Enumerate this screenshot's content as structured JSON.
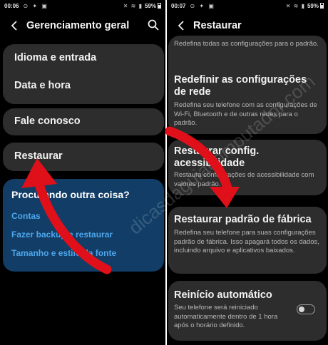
{
  "left": {
    "status": {
      "time": "00:06",
      "battery": "59%"
    },
    "header": {
      "title": "Gerenciamento geral"
    },
    "items": [
      {
        "label": "Idioma e entrada"
      },
      {
        "label": "Data e hora"
      },
      {
        "label": "Fale conosco"
      },
      {
        "label": "Restaurar"
      }
    ],
    "suggestions": {
      "heading": "Procurando outra coisa?",
      "links": [
        "Contas",
        "Fazer backup e restaurar",
        "Tamanho e estilo da fonte"
      ]
    }
  },
  "right": {
    "status": {
      "time": "00:07",
      "battery": "59%"
    },
    "header": {
      "title": "Restaurar"
    },
    "top_partial_desc": "Redefina todas as configurações para o padrão.",
    "options": [
      {
        "title": "Redefinir as configurações de rede",
        "desc": "Redefina seu telefone com as configurações de Wi-Fi, Bluetooth e de outras redes para o padrão."
      },
      {
        "title": "Restaurar config. acessibilidade",
        "desc": "Restaura configurações de acessibilidade com valores padrão."
      },
      {
        "title": "Restaurar padrão de fábrica",
        "desc": "Redefina seu telefone para suas configurações padrão de fábrica. Isso apagará todos os dados, incluindo arquivo e aplicativos baixados."
      },
      {
        "title": "Reinício automático",
        "desc": "Seu telefone será reiniciado automaticamente dentro de 1 hora após o horário definido.",
        "toggle_on": false
      }
    ]
  },
  "watermark": "dicasdaguiacomputador.com",
  "colors": {
    "background": "#000000",
    "card": "#2d2d2d",
    "suggest_card": "#113d66",
    "link": "#4ea6ec",
    "arrow": "#e0101a"
  }
}
